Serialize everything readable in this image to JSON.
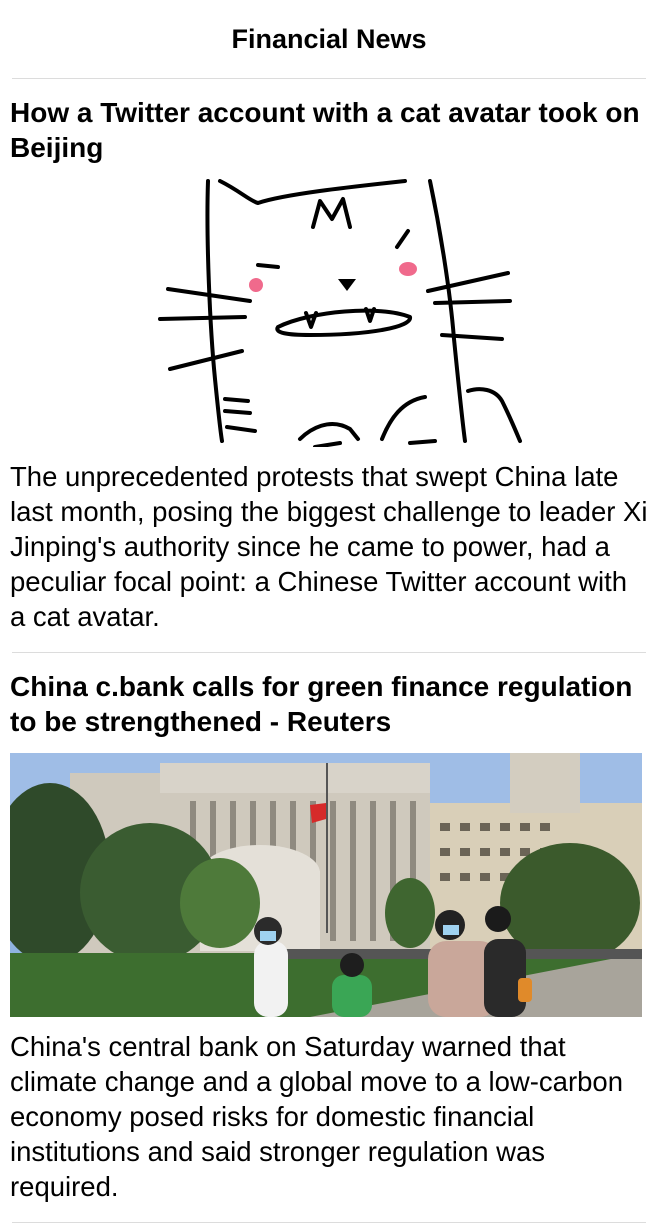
{
  "nav": {
    "title": "Financial News"
  },
  "articles": [
    {
      "title": "How a Twitter account with a cat avatar took on Beijing",
      "image_icon": "cat-drawing-image",
      "summary": "The unprecedented protests that swept China late last month, posing the biggest challenge to leader Xi Jinping's authority since he came to power, had a peculiar focal point: a Chinese Twitter account with a cat avatar."
    },
    {
      "title": "China c.bank calls for green finance regulation to be strengthened - Reuters",
      "image_icon": "central-bank-photo",
      "summary": "China's central bank on Saturday warned that climate change and a global move to a low-carbon economy posed risks for domestic financial institutions and said stronger regulation was required."
    }
  ],
  "colors": {
    "cheek": "#f06a8c",
    "sky": "#8fb3e0",
    "grass": "#3d6e2f"
  }
}
